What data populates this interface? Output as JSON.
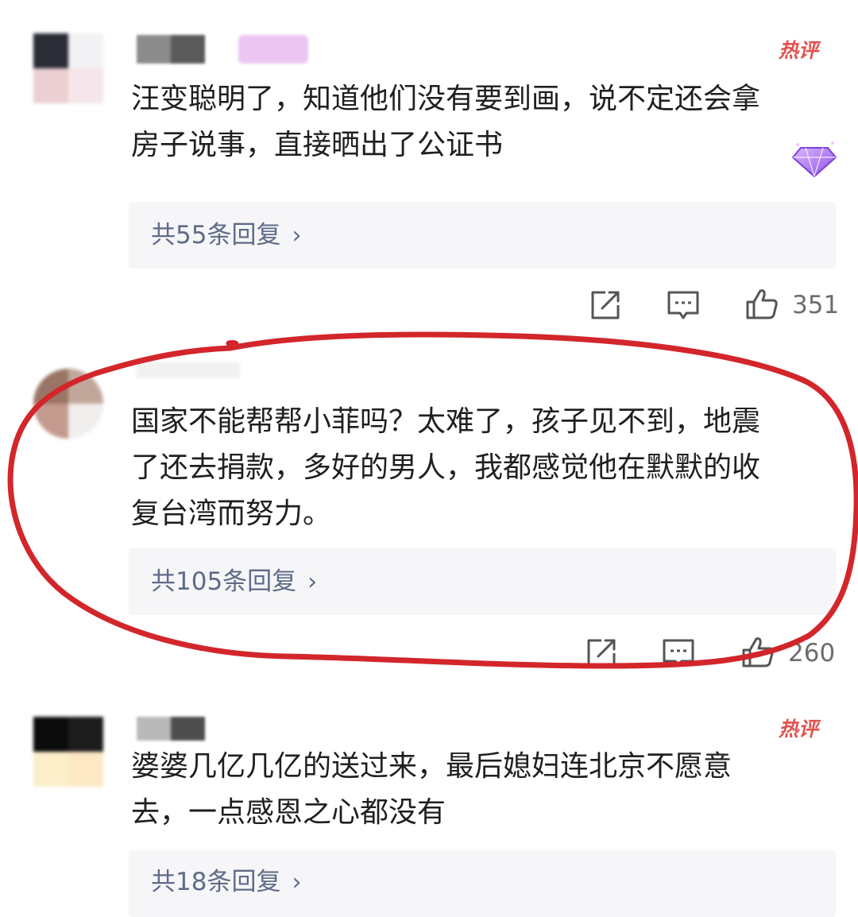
{
  "colors": {
    "accent_red": "#d2262b",
    "hot_badge": "#e2524d",
    "reply_link": "#5f6b87",
    "reply_bg": "#f6f6f8",
    "text": "#1f1f1f",
    "meta": "#6d6d6d"
  },
  "comments": [
    {
      "text_lines": [
        "汪变聪明了，知道他们没有要到画，说不定还会拿",
        "房子说事，直接晒出了公证书"
      ],
      "badge": "热评",
      "replies_label": "共55条回复",
      "like_count": "351",
      "icons": [
        "share-icon",
        "comment-icon",
        "thumbs-up-icon",
        "diamond-badge-icon"
      ]
    },
    {
      "text_lines": [
        "国家不能帮帮小菲吗？太难了，孩子见不到，地震",
        "了还去捐款，多好的男人，我都感觉他在默默的收",
        "复台湾而努力。"
      ],
      "badge": "",
      "replies_label": "共105条回复",
      "like_count": "260",
      "icons": [
        "share-icon",
        "comment-icon",
        "thumbs-up-icon"
      ]
    },
    {
      "text_lines": [
        "婆婆几亿几亿的送过来，最后媳妇连北京不愿意",
        "去，一点感恩之心都没有"
      ],
      "badge": "热评",
      "replies_label": "共18条回复",
      "like_count": "",
      "icons": []
    }
  ],
  "annotation": {
    "type": "hand-drawn-circle",
    "color": "#d2262b"
  }
}
